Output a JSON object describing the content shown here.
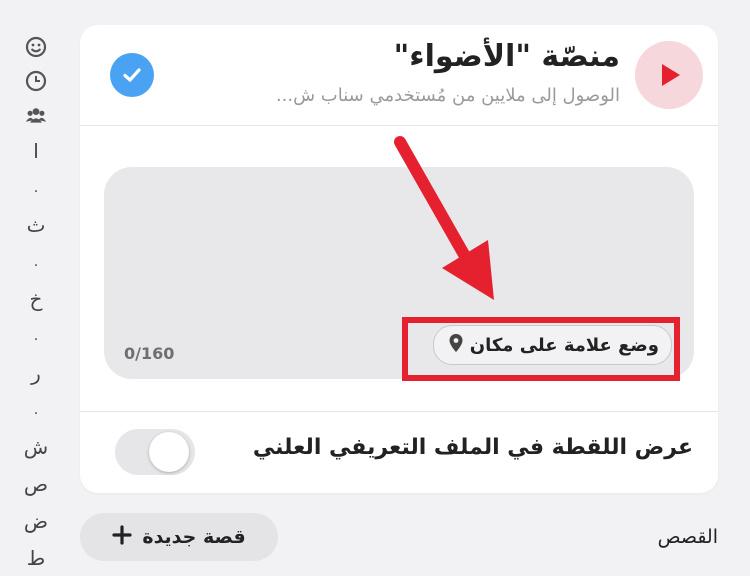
{
  "sidebar_index": {
    "icons": [
      "smiley-icon",
      "clock-icon",
      "friends-icon"
    ],
    "letters": [
      "ا",
      ".",
      "ث",
      ".",
      "خ",
      ".",
      "ر",
      ".",
      "ش",
      "ص",
      "ض",
      "ط"
    ]
  },
  "header": {
    "title": "منصّة \"الأضواء\"",
    "subtitle": "الوصول إلى ملايين من مُستخدمي سناب ش..."
  },
  "caption": {
    "counter": "0/160",
    "location_button": "وضع علامة على مكان"
  },
  "toggle_row": {
    "label": "عرض اللقطة في الملف التعريفي العلني",
    "enabled": false
  },
  "bottom": {
    "new_story": "قصة جديدة",
    "stories": "القصص"
  },
  "colors": {
    "accent_red": "#e5212f",
    "check_blue": "#4aa3f2",
    "spotlight_pink": "#f6d7dc"
  }
}
